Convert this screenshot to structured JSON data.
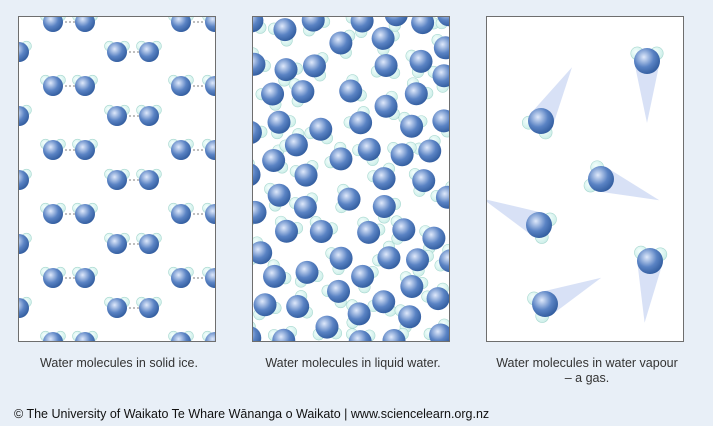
{
  "panels": [
    {
      "caption": "Water molecules in solid ice."
    },
    {
      "caption": "Water molecules in liquid water."
    },
    {
      "caption_line1": "Water molecules in water vapour",
      "caption_line2": "– a gas."
    }
  ],
  "footer": "© The University of Waikato Te Whare Wānanga o Waikato | www.sciencelearn.org.nz",
  "colors": {
    "background": "#e8eff7",
    "oxygen": "#5a83c4",
    "hydrogen": "#c8ece6",
    "bond": "#555555"
  }
}
